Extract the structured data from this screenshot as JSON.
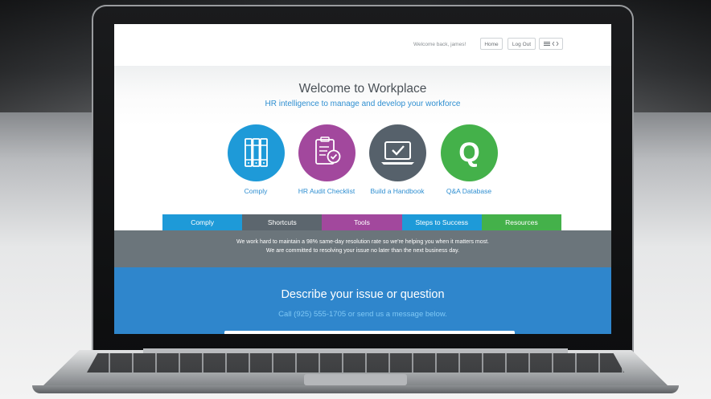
{
  "header": {
    "welcome": "Welcome back, james!",
    "home_label": "Home",
    "logout_label": "Log Out",
    "menu_icon": "hamburger-icon",
    "code_icon": "code-icon"
  },
  "hero": {
    "title": "Welcome to Workplace",
    "subtitle": "HR intelligence to manage and develop your workforce"
  },
  "features": [
    {
      "label": "Comply",
      "icon": "binders-icon",
      "color": "#1e9ad8"
    },
    {
      "label": "HR Audit Checklist",
      "icon": "clipboard-check-icon",
      "color": "#a2489d"
    },
    {
      "label": "Build a Handbook",
      "icon": "laptop-check-icon",
      "color": "#56616b"
    },
    {
      "label": "Q&A Database",
      "icon": "q-letter-icon",
      "color": "#44b14a"
    }
  ],
  "tabs": [
    {
      "label": "Comply",
      "color": "#1e9ad8"
    },
    {
      "label": "Shortcuts",
      "color": "#5c666e"
    },
    {
      "label": "Tools",
      "color": "#a2489d"
    },
    {
      "label": "Steps to Success",
      "color": "#1e9ad8"
    },
    {
      "label": "Resources",
      "color": "#44b14a"
    }
  ],
  "notice": {
    "line1": "We work hard to maintain a 98% same-day resolution rate so we're helping you when it matters most.",
    "line2": "We are committed to resolving your issue no later than the next business day."
  },
  "issue": {
    "title": "Describe your issue or question",
    "subtitle": "Call (925) 555-1705 or send us a message below."
  }
}
